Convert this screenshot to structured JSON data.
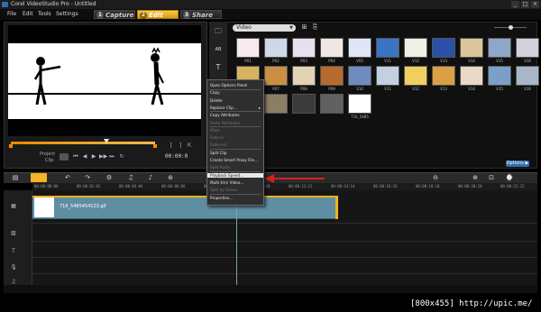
{
  "window": {
    "title": "Corel VideoStudio Pro - Untitled",
    "buttons": [
      "_",
      "□",
      "×"
    ]
  },
  "menu": {
    "items": [
      "File",
      "Edit",
      "Tools",
      "Settings"
    ]
  },
  "steps": [
    {
      "num": "1",
      "label": "Capture"
    },
    {
      "num": "2",
      "label": "Edit"
    },
    {
      "num": "3",
      "label": "Share"
    }
  ],
  "preview": {
    "mode_label": "Project",
    "clip_label": "Clip",
    "timecode": "00:00:0",
    "controls": [
      "⏮",
      "◀",
      "▶",
      "▶▶",
      "⏭",
      "↻"
    ],
    "edge_controls": [
      "[",
      "]",
      "⇱"
    ]
  },
  "library": {
    "dropdown": "Video",
    "side_icons": [
      "🗀",
      "AB",
      "T"
    ],
    "thumbs_row1": [
      "P01",
      "P02",
      "P03",
      "P04",
      "V05",
      "V11",
      "V12",
      "V13",
      "V14",
      "V15",
      "V16"
    ],
    "thumbs_row2": [
      "P06",
      "P07",
      "P08",
      "P09",
      "V10",
      "V11",
      "V12",
      "V13",
      "V14",
      "V15",
      "V16"
    ],
    "thumbs_row3": [
      "",
      "",
      "",
      "",
      "716_5485",
      "",
      "",
      "",
      "",
      "",
      ""
    ],
    "options_label": "Options ▶"
  },
  "timeline": {
    "ticks": [
      "00:00:00:00",
      "00:00:02:02",
      "00:00:04:04",
      "00:00:06:06",
      "00:00:08:08",
      "00:00:10:10",
      "00:00:12:12",
      "00:00:14:14",
      "00:00:16:16",
      "00:00:18:18",
      "00:00:20:20",
      "00:00:22:22"
    ],
    "clip_name": "716_5485454123.gif"
  },
  "context_menu": {
    "items": [
      {
        "label": "Open Options Panel",
        "disabled": false
      },
      {
        "label": "Copy",
        "disabled": false
      },
      {
        "label": "Delete",
        "disabled": false
      },
      {
        "label": "Replace Clip...",
        "disabled": false,
        "submenu": true
      },
      {
        "label": "Copy Attributes",
        "disabled": false
      },
      {
        "label": "Paste Attributes",
        "disabled": true
      },
      {
        "label": "Mute",
        "disabled": true
      },
      {
        "label": "Fade-in",
        "disabled": true
      },
      {
        "label": "Fade-out",
        "disabled": true
      },
      {
        "label": "Split Clip",
        "disabled": false
      },
      {
        "label": "Create Smart Proxy File...",
        "disabled": false
      },
      {
        "label": "Split Audio",
        "disabled": true
      },
      {
        "label": "Playback Speed...",
        "disabled": false,
        "hover": true
      },
      {
        "label": "Multi-trim Video...",
        "disabled": false
      },
      {
        "label": "Split by Scene...",
        "disabled": true
      },
      {
        "label": "Properties...",
        "disabled": false
      }
    ]
  },
  "colors": {
    "accent": "#f4b423",
    "clip": "#5f8ea3",
    "arrow": "#d42020"
  },
  "watermark": "[800x455] http://upic.me/"
}
